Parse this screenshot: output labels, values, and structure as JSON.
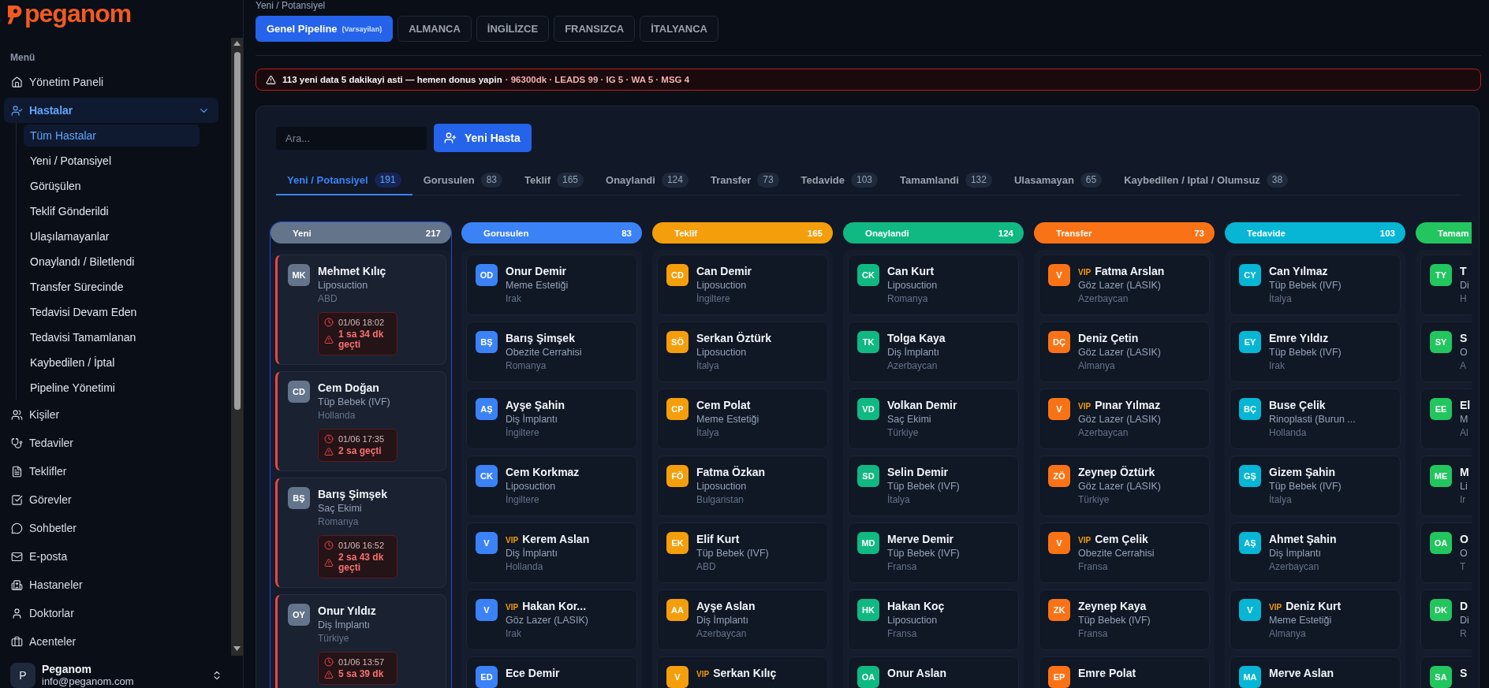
{
  "sidebar": {
    "logo": "peganom",
    "section_label": "Menü",
    "items": [
      {
        "label": "Yönetim Paneli",
        "selected": false
      },
      {
        "label": "Hastalar",
        "selected": true,
        "expanded": true,
        "children": [
          {
            "label": "Tüm Hastalar",
            "selected": true
          },
          {
            "label": "Yeni / Potansiyel",
            "selected": false
          },
          {
            "label": "Görüşülen",
            "selected": false
          },
          {
            "label": "Teklif Gönderildi",
            "selected": false
          },
          {
            "label": "Ulaşılamayanlar",
            "selected": false
          },
          {
            "label": "Onaylandı / Biletlendi",
            "selected": false
          },
          {
            "label": "Transfer Sürecinde",
            "selected": false
          },
          {
            "label": "Tedavisi Devam Eden",
            "selected": false
          },
          {
            "label": "Tedavisi Tamamlanan",
            "selected": false
          },
          {
            "label": "Kaybedilen / İptal",
            "selected": false
          },
          {
            "label": "Pipeline Yönetimi",
            "selected": false
          }
        ]
      },
      {
        "label": "Kişiler",
        "selected": false
      },
      {
        "label": "Tedaviler",
        "selected": false
      },
      {
        "label": "Teklifler",
        "selected": false
      },
      {
        "label": "Görevler",
        "selected": false
      },
      {
        "label": "Sohbetler",
        "selected": false
      },
      {
        "label": "E-posta",
        "selected": false
      },
      {
        "label": "Hastaneler",
        "selected": false
      },
      {
        "label": "Doktorlar",
        "selected": false
      },
      {
        "label": "Acenteler",
        "selected": false
      }
    ],
    "user": {
      "initial": "P",
      "name": "Peganom",
      "email": "info@peganom.com"
    }
  },
  "breadcrumb": "Yeni / Potansiyel",
  "pipelines": [
    {
      "label": "Genel Pipeline",
      "note": "(Varsayilan)",
      "selected": true
    },
    {
      "label": "ALMANCA",
      "selected": false
    },
    {
      "label": "İNGİLİZCE",
      "selected": false
    },
    {
      "label": "FRANSIZCA",
      "selected": false
    },
    {
      "label": "İTALYANCA",
      "selected": false
    }
  ],
  "alert": {
    "message": "113 yeni data 5 dakikayi asti — hemen donus yapin",
    "details": "· 96300dk · LEADS 99 · IG 5 · WA 5 · MSG 4"
  },
  "search": {
    "placeholder": "Ara..."
  },
  "new_patient_button": "Yeni Hasta",
  "status_tabs": [
    {
      "label": "Yeni / Potansiyel",
      "count": "191",
      "selected": true
    },
    {
      "label": "Gorusulen",
      "count": "83",
      "selected": false
    },
    {
      "label": "Teklif",
      "count": "165",
      "selected": false
    },
    {
      "label": "Onaylandi",
      "count": "124",
      "selected": false
    },
    {
      "label": "Transfer",
      "count": "73",
      "selected": false
    },
    {
      "label": "Tedavide",
      "count": "103",
      "selected": false
    },
    {
      "label": "Tamamlandi",
      "count": "132",
      "selected": false
    },
    {
      "label": "Ulasamayan",
      "count": "65",
      "selected": false
    },
    {
      "label": "Kaybedilen / Iptal / Olumsuz",
      "count": "38",
      "selected": false
    }
  ],
  "columns": [
    {
      "title": "Yeni",
      "count": "217",
      "color": "#64748b",
      "selected": true,
      "cards": [
        {
          "initials": "MK",
          "name": "Mehmet Kılıç",
          "treatment": "Liposuction",
          "country": "ABD",
          "overdue": true,
          "alert": {
            "time": "01/06 18:02",
            "elapsed": "1 sa 34 dk geçti"
          }
        },
        {
          "initials": "CD",
          "name": "Cem Doğan",
          "treatment": "Tüp Bebek (IVF)",
          "country": "Hollanda",
          "overdue": true,
          "alert": {
            "time": "01/06 17:35",
            "elapsed": "2 sa geçti"
          }
        },
        {
          "initials": "BŞ",
          "name": "Barış Şimşek",
          "treatment": "Saç Ekimi",
          "country": "Romanya",
          "overdue": true,
          "alert": {
            "time": "01/06 16:52",
            "elapsed": "2 sa 43 dk geçti"
          }
        },
        {
          "initials": "OY",
          "name": "Onur Yıldız",
          "treatment": "Diş İmplantı",
          "country": "Türkiye",
          "overdue": true,
          "alert": {
            "time": "01/06 13:57",
            "elapsed": "5 sa 39 dk"
          }
        }
      ]
    },
    {
      "title": "Gorusulen",
      "count": "83",
      "color": "#3b82f6",
      "selected": false,
      "cards": [
        {
          "initials": "OD",
          "name": "Onur Demir",
          "treatment": "Meme Estetiği",
          "country": "Irak",
          "overdue": false
        },
        {
          "initials": "BŞ",
          "name": "Barış Şimşek",
          "treatment": "Obezite Cerrahisi",
          "country": "Romanya",
          "overdue": false
        },
        {
          "initials": "AŞ",
          "name": "Ayşe Şahin",
          "treatment": "Diş İmplantı",
          "country": "İngiltere",
          "overdue": false
        },
        {
          "initials": "CK",
          "name": "Cem Korkmaz",
          "treatment": "Liposuction",
          "country": "İngiltere",
          "overdue": false
        },
        {
          "initials": "V",
          "badge": "VIP",
          "name": "Kerem Aslan",
          "treatment": "Diş İmplantı",
          "country": "Hollanda",
          "overdue": false
        },
        {
          "initials": "V",
          "badge": "VIP",
          "name": "Hakan Kor...",
          "treatment": "Göz Lazer (LASIK)",
          "country": "Irak",
          "overdue": false
        },
        {
          "initials": "ED",
          "name": "Ece Demir",
          "overdue": false
        }
      ]
    },
    {
      "title": "Teklif",
      "count": "165",
      "color": "#f59e0b",
      "selected": false,
      "cards": [
        {
          "initials": "CD",
          "name": "Can Demir",
          "treatment": "Liposuction",
          "country": "İngiltere",
          "overdue": false
        },
        {
          "initials": "SÖ",
          "name": "Serkan Öztürk",
          "treatment": "Liposuction",
          "country": "İtalya",
          "overdue": false
        },
        {
          "initials": "CP",
          "name": "Cem Polat",
          "treatment": "Meme Estetiği",
          "country": "İtalya",
          "overdue": false
        },
        {
          "initials": "FÖ",
          "name": "Fatma Özkan",
          "treatment": "Liposuction",
          "country": "Bulgaristan",
          "overdue": false
        },
        {
          "initials": "EK",
          "name": "Elif Kurt",
          "treatment": "Tüp Bebek (IVF)",
          "country": "ABD",
          "overdue": false
        },
        {
          "initials": "AA",
          "name": "Ayşe Aslan",
          "treatment": "Diş İmplantı",
          "country": "Azerbaycan",
          "overdue": false
        },
        {
          "initials": "V",
          "badge": "VIP",
          "name": "Serkan Kılıç",
          "overdue": false
        }
      ]
    },
    {
      "title": "Onaylandi",
      "count": "124",
      "color": "#10b981",
      "selected": false,
      "cards": [
        {
          "initials": "CK",
          "name": "Can Kurt",
          "treatment": "Liposuction",
          "country": "Romanya",
          "overdue": false
        },
        {
          "initials": "TK",
          "name": "Tolga Kaya",
          "treatment": "Diş İmplantı",
          "country": "Azerbaycan",
          "overdue": false
        },
        {
          "initials": "VD",
          "name": "Volkan Demir",
          "treatment": "Saç Ekimi",
          "country": "Türkiye",
          "overdue": false
        },
        {
          "initials": "SD",
          "name": "Selin Demir",
          "treatment": "Tüp Bebek (IVF)",
          "country": "İtalya",
          "overdue": false
        },
        {
          "initials": "MD",
          "name": "Merve Demir",
          "treatment": "Tüp Bebek (IVF)",
          "country": "Fransa",
          "overdue": false
        },
        {
          "initials": "HK",
          "name": "Hakan Koç",
          "treatment": "Liposuction",
          "country": "Fransa",
          "overdue": false
        },
        {
          "initials": "OA",
          "name": "Onur Aslan",
          "overdue": false
        }
      ]
    },
    {
      "title": "Transfer",
      "count": "73",
      "color": "#f97316",
      "selected": false,
      "cards": [
        {
          "initials": "V",
          "badge": "VIP",
          "name": "Fatma Arslan",
          "treatment": "Göz Lazer (LASIK)",
          "country": "Azerbaycan",
          "overdue": false
        },
        {
          "initials": "DÇ",
          "name": "Deniz Çetin",
          "treatment": "Göz Lazer (LASIK)",
          "country": "Almanya",
          "overdue": false
        },
        {
          "initials": "V",
          "badge": "VIP",
          "name": "Pınar Yılmaz",
          "treatment": "Göz Lazer (LASIK)",
          "country": "Azerbaycan",
          "overdue": false
        },
        {
          "initials": "ZÖ",
          "name": "Zeynep Öztürk",
          "treatment": "Göz Lazer (LASIK)",
          "country": "Türkiye",
          "overdue": false
        },
        {
          "initials": "V",
          "badge": "VIP",
          "name": "Cem Çelik",
          "treatment": "Obezite Cerrahisi",
          "country": "Fransa",
          "overdue": false
        },
        {
          "initials": "ZK",
          "name": "Zeynep Kaya",
          "treatment": "Tüp Bebek (IVF)",
          "country": "Fransa",
          "overdue": false
        },
        {
          "initials": "EP",
          "name": "Emre Polat",
          "overdue": false
        }
      ]
    },
    {
      "title": "Tedavide",
      "count": "103",
      "color": "#06b6d4",
      "selected": false,
      "cards": [
        {
          "initials": "CY",
          "name": "Can Yılmaz",
          "treatment": "Tüp Bebek (IVF)",
          "country": "İtalya",
          "overdue": false
        },
        {
          "initials": "EY",
          "name": "Emre Yıldız",
          "treatment": "Tüp Bebek (IVF)",
          "country": "Irak",
          "overdue": false
        },
        {
          "initials": "BÇ",
          "name": "Buse Çelik",
          "treatment": "Rinoplasti (Burun ...",
          "country": "Hollanda",
          "overdue": false
        },
        {
          "initials": "GŞ",
          "name": "Gizem Şahin",
          "treatment": "Tüp Bebek (IVF)",
          "country": "İtalya",
          "overdue": false
        },
        {
          "initials": "AŞ",
          "name": "Ahmet Şahin",
          "treatment": "Diş İmplantı",
          "country": "Azerbaycan",
          "overdue": false
        },
        {
          "initials": "V",
          "badge": "VIP",
          "name": "Deniz Kurt",
          "treatment": "Meme Estetiği",
          "country": "Almanya",
          "overdue": false
        },
        {
          "initials": "MA",
          "name": "Merve Aslan",
          "overdue": false
        }
      ]
    },
    {
      "title": "Tamam",
      "color": "#22c55e",
      "selected": false,
      "cards": [
        {
          "initials": "TY",
          "name": "T",
          "treatment": "Di",
          "country": "H",
          "overdue": false
        },
        {
          "initials": "SY",
          "name": "S",
          "treatment": "O",
          "country": "A",
          "overdue": false
        },
        {
          "initials": "EE",
          "name": "El",
          "treatment": "M",
          "country": "Al",
          "overdue": false
        },
        {
          "initials": "ME",
          "name": "M",
          "treatment": "Li",
          "country": "Ir",
          "overdue": false
        },
        {
          "initials": "OA",
          "name": "O",
          "treatment": "O",
          "country": "T",
          "overdue": false
        },
        {
          "initials": "DK",
          "name": "D",
          "treatment": "Di",
          "country": "R",
          "overdue": false
        },
        {
          "initials": "SA",
          "name": "S",
          "overdue": false
        }
      ]
    }
  ]
}
